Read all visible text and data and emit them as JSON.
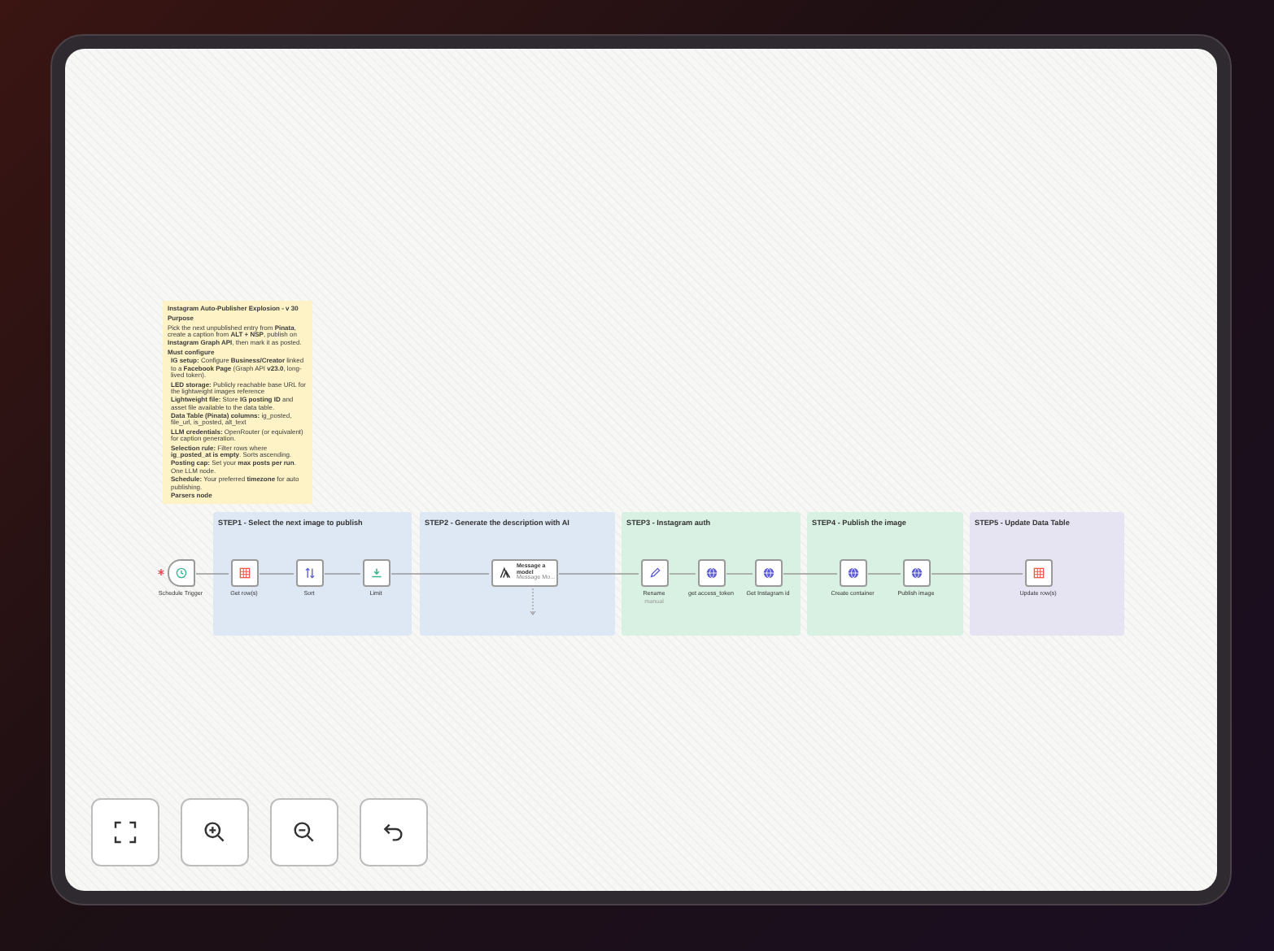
{
  "sticky_note": {
    "title": "Instagram Auto-Publisher Explosion - v 30",
    "sections": [
      {
        "heading": "Purpose",
        "text": "Pick the next unpublished entry from **Pinata**, create a caption from **ALT + NSP**, publish on **Instagram Graph API**, then mark it as posted."
      },
      {
        "heading": "Must configure",
        "bullets": [
          "**IG setup:** Configure **Business/Creator** linked to a **Facebook Page** (Graph API **v23.0**, long-lived token).",
          "**LED storage:** Publicly reachable base URL for the lightweight images reference",
          "**Lightweight file:** Store **IG posting ID** and asset file available to the data table.",
          "**Data Table (Pinata) columns:** ig_posted, file_url, is_posted, alt_text",
          "**LLM credentials:** OpenRouter (or equivalent) for caption generation.",
          "**Selection rule:** Filter rows where **ig_posted_at is empty**. Sorts ascending.",
          "**Posting cap:** Set your **max posts per run**. One LLM node.",
          "**Schedule:** Your preferred **timezone** for auto publishing.",
          "**Parsers node**"
        ]
      }
    ]
  },
  "groups": [
    {
      "title": "STEP1 - Select the next image to publish",
      "color": "#dde8f4"
    },
    {
      "title": "STEP2 - Generate the description with AI",
      "color": "#dde8f4"
    },
    {
      "title": "STEP3 - Instagram auth",
      "color": "#d9f1e2"
    },
    {
      "title": "STEP4 - Publish the image",
      "color": "#d9f1e2"
    },
    {
      "title": "STEP5 - Update Data Table",
      "color": "#e6e4f3"
    }
  ],
  "nodes": [
    {
      "kind": "trigger",
      "label": "Schedule Trigger"
    },
    {
      "kind": "table",
      "label": "Get row(s)"
    },
    {
      "kind": "sort",
      "label": "Sort"
    },
    {
      "kind": "limit",
      "label": "Limit"
    },
    {
      "kind": "ai",
      "label": "Message a model",
      "subtitle": "Message Mo..."
    },
    {
      "kind": "edit",
      "label": "Rename",
      "subtitle": "manual"
    },
    {
      "kind": "http",
      "label": "get access_token"
    },
    {
      "kind": "http",
      "label": "Get Instagram id"
    },
    {
      "kind": "http",
      "label": "Create container"
    },
    {
      "kind": "http",
      "label": "Publish image"
    },
    {
      "kind": "table",
      "label": "Update row(s)"
    }
  ],
  "controls": [
    {
      "kind": "fit"
    },
    {
      "kind": "zoom_in"
    },
    {
      "kind": "zoom_out"
    },
    {
      "kind": "undo"
    }
  ]
}
